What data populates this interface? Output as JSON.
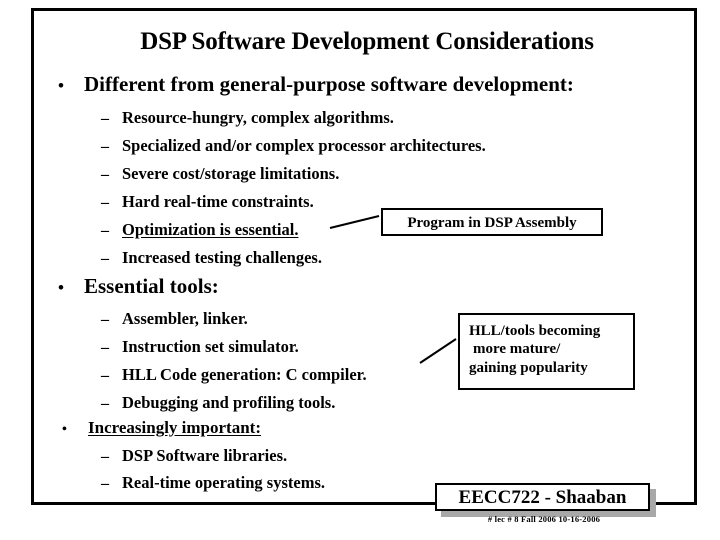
{
  "slide": {
    "title": "DSP Software Development Considerations",
    "bullet_glyph": "•",
    "dash_glyph": "–",
    "sections": [
      {
        "heading": "Different from general-purpose software development:",
        "underlined": false,
        "items": [
          {
            "text": "Resource-hungry, complex algorithms.",
            "underlined": false
          },
          {
            "text": "Specialized and/or complex processor architectures.",
            "underlined": false
          },
          {
            "text": "Severe cost/storage limitations.",
            "underlined": false
          },
          {
            "text": "Hard real-time constraints.",
            "underlined": false
          },
          {
            "text": "Optimization is essential.",
            "underlined": true
          },
          {
            "text": "Increased testing challenges.",
            "underlined": false
          }
        ]
      },
      {
        "heading": "Essential tools:",
        "underlined": false,
        "items": [
          {
            "text": "Assembler, linker.",
            "underlined": false
          },
          {
            "text": "Instruction set simulator.",
            "underlined": false
          },
          {
            "text": "HLL  Code generation:  C compiler.",
            "underlined": false
          },
          {
            "text": "Debugging and profiling tools.",
            "underlined": false
          }
        ]
      },
      {
        "heading": "Increasingly important:",
        "underlined": true,
        "items": [
          {
            "text": "DSP Software libraries.",
            "underlined": false
          },
          {
            "text": "Real-time operating systems.",
            "underlined": false
          }
        ]
      }
    ],
    "callouts": {
      "assembly": {
        "text": "Program in DSP Assembly"
      },
      "hll": {
        "line1": "HLL/tools becoming",
        "line2": "more mature/",
        "line3": "gaining popularity"
      }
    },
    "footer": {
      "course": "EECC722 - Shaaban",
      "subline": "#  lec # 8    Fall 2006   10-16-2006"
    },
    "colors": {
      "ink": "#000000",
      "background": "#ffffff",
      "shadow": "#a8a8a8"
    }
  }
}
